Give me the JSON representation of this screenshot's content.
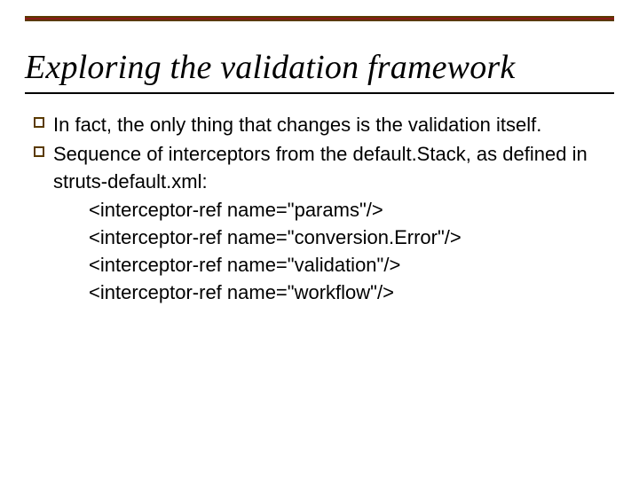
{
  "title": "Exploring the validation framework",
  "bullets": [
    {
      "text": "In fact, the only thing that changes is the validation itself."
    },
    {
      "text": "Sequence of interceptors from the default.Stack, as defined in struts-default.xml:"
    }
  ],
  "code": [
    "<interceptor-ref name=\"params\"/>",
    "<interceptor-ref name=\"conversion.Error\"/>",
    "<interceptor-ref name=\"validation\"/>",
    "<interceptor-ref name=\"workflow\"/>"
  ]
}
